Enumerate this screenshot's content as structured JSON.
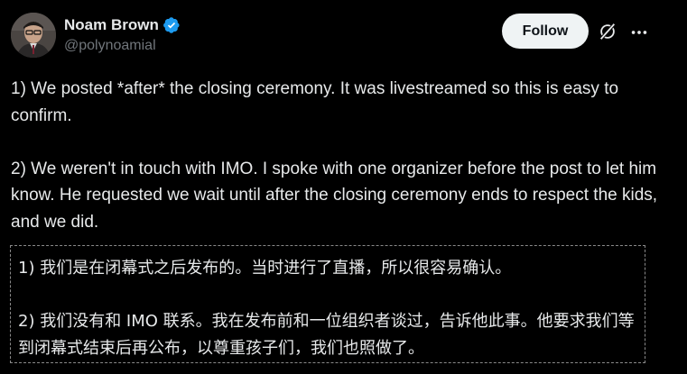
{
  "author": {
    "display_name": "Noam Brown",
    "handle": "@polynoamial",
    "verified": true,
    "verified_color": "#1d9bf0"
  },
  "actions": {
    "follow_label": "Follow",
    "grok_icon": "grok-icon",
    "more_icon": "more-horizontal-icon"
  },
  "tweet": {
    "paragraph_1": "1) We posted *after* the closing ceremony. It was livestreamed so this is easy to confirm.",
    "paragraph_2": "2) We weren't in touch with IMO. I spoke with one organizer before the post to let him know. He requested we wait until after the closing ceremony ends to respect the kids, and we did."
  },
  "translation": {
    "paragraph_1": "1) 我们是在闭幕式之后发布的。当时进行了直播，所以很容易确认。",
    "paragraph_2": "2) 我们没有和 IMO 联系。我在发布前和一位组织者谈过，告诉他此事。他要求我们等到闭幕式结束后再公布，以尊重孩子们，我们也照做了。"
  },
  "colors": {
    "background": "#000000",
    "text_primary": "#e7e9ea",
    "text_secondary": "#71767b",
    "follow_bg": "#eff3f4",
    "follow_text": "#0f1419"
  }
}
